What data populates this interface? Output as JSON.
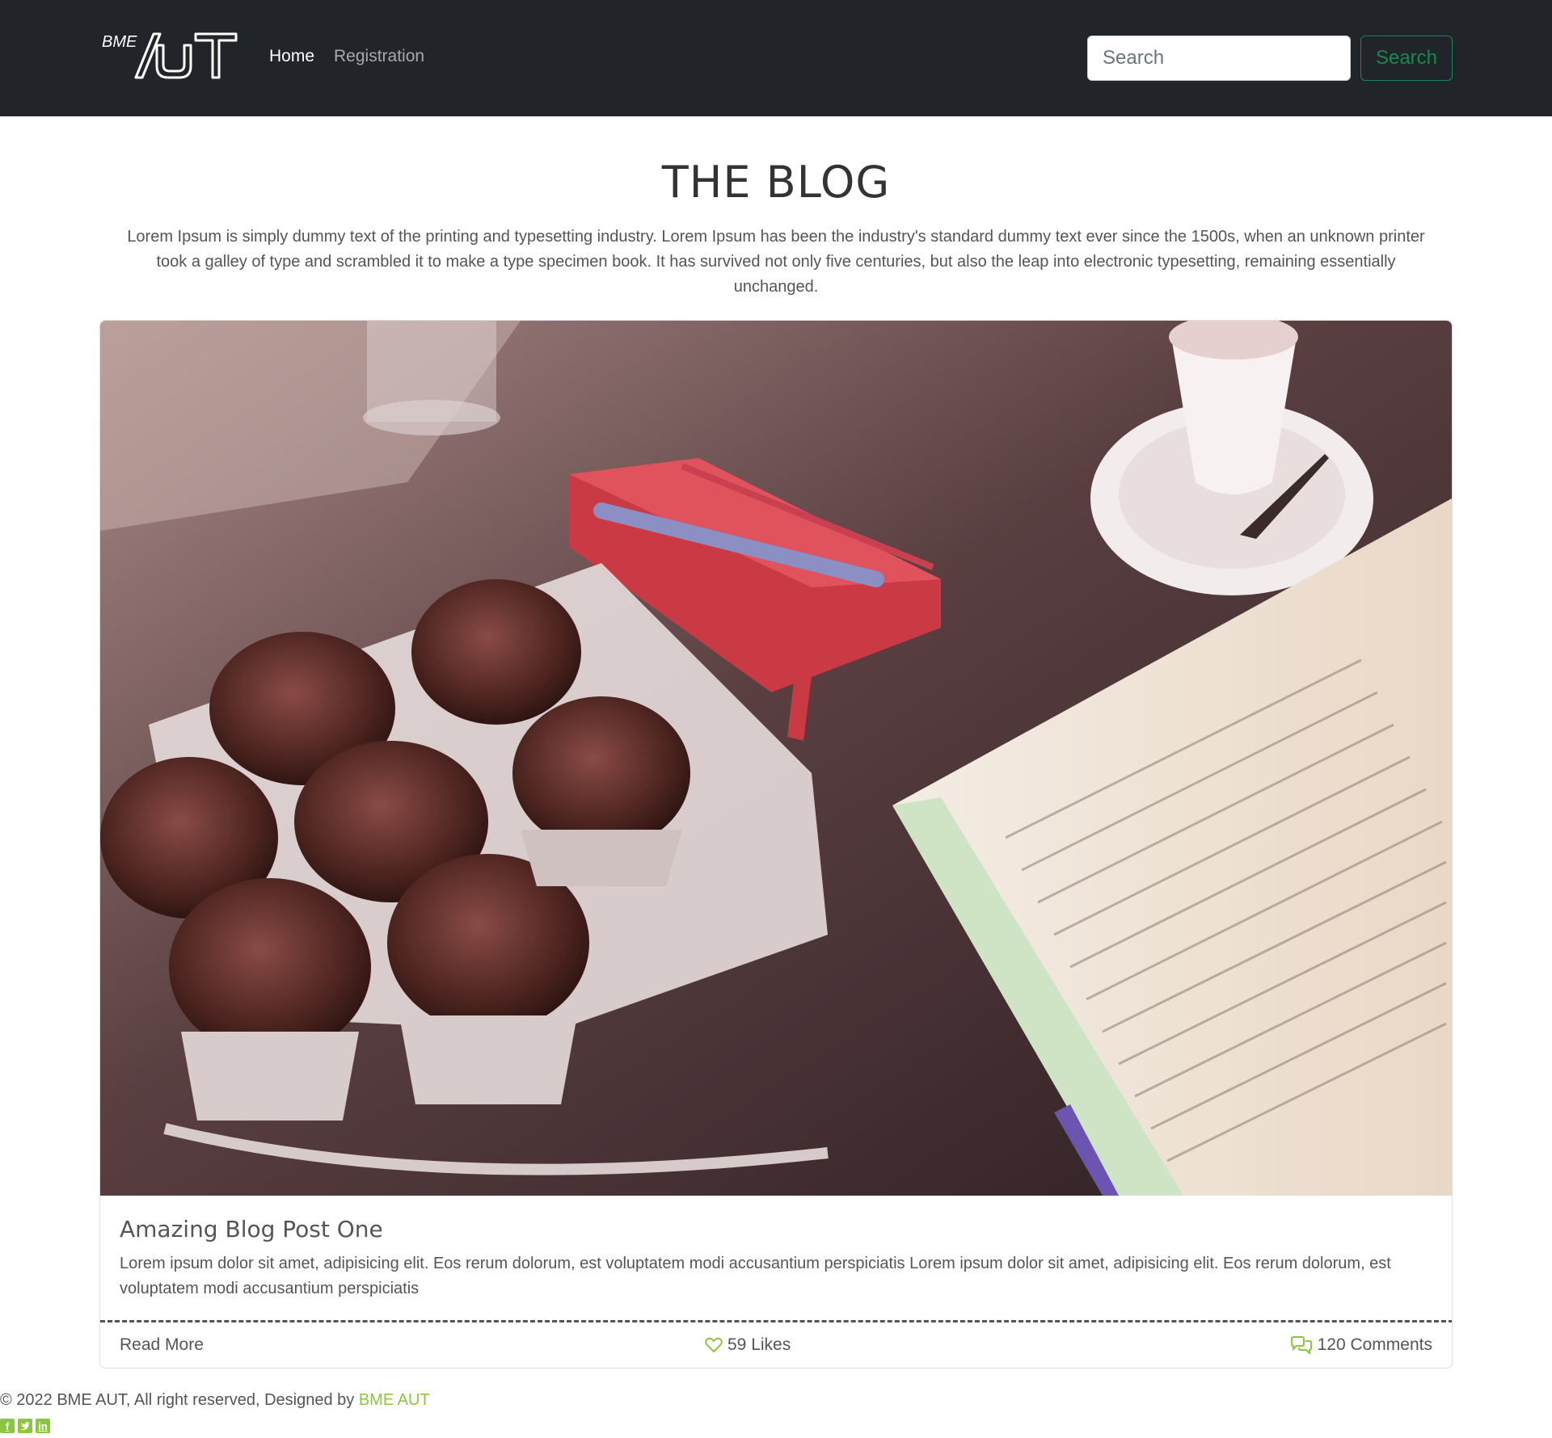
{
  "navbar": {
    "brand_text": "BME AUT",
    "links": [
      {
        "label": "Home",
        "active": true
      },
      {
        "label": "Registration",
        "active": false
      }
    ],
    "search": {
      "placeholder": "Search",
      "value": "",
      "button_label": "Search"
    }
  },
  "header": {
    "title": "THE BLOG",
    "intro": "Lorem Ipsum is simply dummy text of the printing and typesetting industry. Lorem Ipsum has been the industry's standard dummy text ever since the 1500s, when an unknown printer took a galley of type and scrambled it to make a type specimen book. It has survived not only five centuries, but also the leap into electronic typesetting, remaining essentially unchanged."
  },
  "post": {
    "title": "Amazing Blog Post One",
    "text": "Lorem ipsum dolor sit amet, adipisicing elit. Eos rerum dolorum, est voluptatem modi accusantium perspiciatis Lorem ipsum dolor sit amet, adipisicing elit. Eos rerum dolorum, est voluptatem modi accusantium perspiciatis",
    "read_more": "Read More",
    "likes": "59 Likes",
    "comments": "120 Comments"
  },
  "footer": {
    "copyright_prefix": "© 2022 BME AUT, All right reserved, Designed by",
    "designer_link": "BME AUT",
    "socials": [
      "facebook-icon",
      "twitter-icon",
      "linkedin-icon"
    ]
  },
  "colors": {
    "navbar_bg": "#212529",
    "accent_green": "#198754",
    "link_green": "#8cc63f"
  }
}
